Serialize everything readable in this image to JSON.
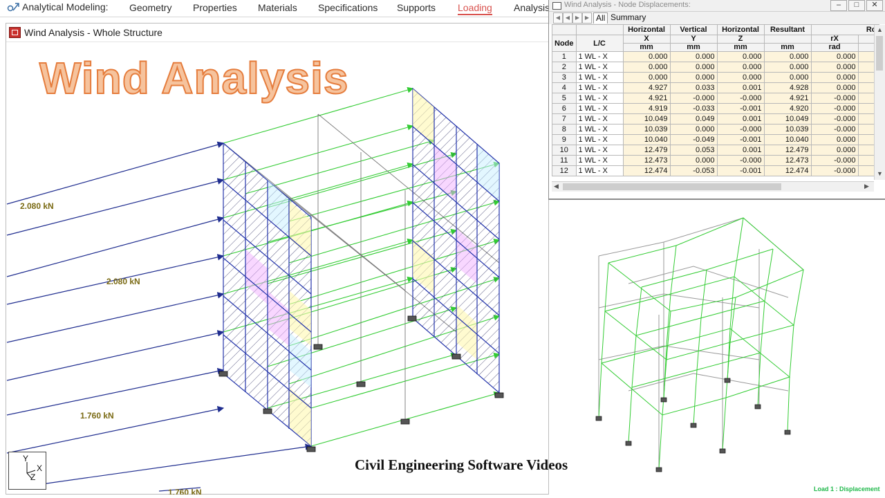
{
  "menu": {
    "prefix": "Analytical Modeling:",
    "items": [
      {
        "label": "Geometry"
      },
      {
        "label": "Properties"
      },
      {
        "label": "Materials"
      },
      {
        "label": "Specifications"
      },
      {
        "label": "Supports"
      },
      {
        "label": "Loading",
        "active": true
      },
      {
        "label": "Analysis"
      }
    ]
  },
  "main_window": {
    "title": "Wind Analysis - Whole Structure",
    "overlay_title": "Wind Analysis",
    "load_labels": [
      "2.080 kN",
      "2.080 kN",
      "1.760 kN",
      "1.760 kN"
    ],
    "axis": {
      "y": "Y",
      "x": "X",
      "z": "Z"
    }
  },
  "branding": "Civil Engineering Software Videos",
  "table_window": {
    "title": "Wind Analysis - Node Displacements:",
    "tabs": [
      "All",
      "Summary"
    ],
    "header_top": [
      "Horizontal",
      "Vertical",
      "Horizontal",
      "Resultant",
      "Ro"
    ],
    "header_mid": [
      "Node",
      "L/C",
      "X",
      "Y",
      "Z",
      "",
      "rX"
    ],
    "header_units": [
      "mm",
      "mm",
      "mm",
      "mm",
      "rad"
    ],
    "rows": [
      [
        "1",
        "1 WL - X",
        "0.000",
        "0.000",
        "0.000",
        "0.000",
        "0.000"
      ],
      [
        "2",
        "1 WL - X",
        "0.000",
        "0.000",
        "0.000",
        "0.000",
        "0.000"
      ],
      [
        "3",
        "1 WL - X",
        "0.000",
        "0.000",
        "0.000",
        "0.000",
        "0.000"
      ],
      [
        "4",
        "1 WL - X",
        "4.927",
        "0.033",
        "0.001",
        "4.928",
        "0.000"
      ],
      [
        "5",
        "1 WL - X",
        "4.921",
        "-0.000",
        "-0.000",
        "4.921",
        "-0.000"
      ],
      [
        "6",
        "1 WL - X",
        "4.919",
        "-0.033",
        "-0.001",
        "4.920",
        "-0.000"
      ],
      [
        "7",
        "1 WL - X",
        "10.049",
        "0.049",
        "0.001",
        "10.049",
        "-0.000"
      ],
      [
        "8",
        "1 WL - X",
        "10.039",
        "0.000",
        "-0.000",
        "10.039",
        "-0.000"
      ],
      [
        "9",
        "1 WL - X",
        "10.040",
        "-0.049",
        "-0.001",
        "10.040",
        "0.000"
      ],
      [
        "10",
        "1 WL - X",
        "12.479",
        "0.053",
        "0.001",
        "12.479",
        "0.000"
      ],
      [
        "11",
        "1 WL - X",
        "12.473",
        "0.000",
        "-0.000",
        "12.473",
        "-0.000"
      ],
      [
        "12",
        "1 WL - X",
        "12.474",
        "-0.053",
        "-0.001",
        "12.474",
        "-0.000"
      ]
    ]
  },
  "displacement_view": {
    "caption": "Load 1 : Displacement"
  },
  "colors": {
    "load_arrow": "#1f2d8f",
    "wind_arrow_green": "#33cc33",
    "member": "#2233aa",
    "active_menu": "#d9534f",
    "displaced": "#33cc33"
  }
}
